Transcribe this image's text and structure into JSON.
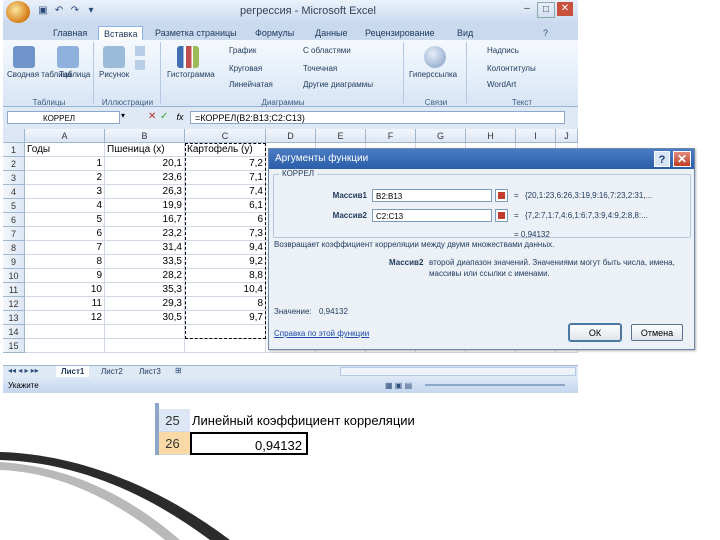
{
  "window": {
    "title": "регрессия - Microsoft Excel"
  },
  "tabs": [
    "Главная",
    "Вставка",
    "Разметка страницы",
    "Формулы",
    "Данные",
    "Рецензирование",
    "Вид"
  ],
  "ribbon": {
    "tables": {
      "pivot": "Сводная таблица",
      "table": "Таблица",
      "group": "Таблицы"
    },
    "illus": {
      "picture": "Рисунок",
      "group": "Иллюстрации"
    },
    "charts": {
      "histogram": "Гистограмма",
      "graph": "График",
      "pie": "Круговая",
      "linear": "Линейчатая",
      "area": "С областями",
      "scatter": "Точечная",
      "other": "Другие диаграммы",
      "group": "Диаграммы"
    },
    "links": {
      "hyperlink": "Гиперссылка",
      "group": "Связи"
    },
    "text": {
      "caption": "Надпись",
      "header": "Колонтитулы",
      "wordart": "WordArt",
      "group": "Текст"
    }
  },
  "namebox": "КОРРЕЛ",
  "fx": "fx",
  "formula": "=КОРРЕЛ(B2:B13;C2:C13)",
  "columns": [
    "A",
    "B",
    "C",
    "D",
    "E",
    "F",
    "G",
    "H",
    "I",
    "J"
  ],
  "rows": [
    {
      "n": "1",
      "a": "Годы",
      "b": "Пшеница (x)",
      "c": "Картофель (y)"
    },
    {
      "n": "2",
      "a": "1",
      "b": "20,1",
      "c": "7,2"
    },
    {
      "n": "3",
      "a": "2",
      "b": "23,6",
      "c": "7,1"
    },
    {
      "n": "4",
      "a": "3",
      "b": "26,3",
      "c": "7,4"
    },
    {
      "n": "5",
      "a": "4",
      "b": "19,9",
      "c": "6,1"
    },
    {
      "n": "6",
      "a": "5",
      "b": "16,7",
      "c": "6"
    },
    {
      "n": "7",
      "a": "6",
      "b": "23,2",
      "c": "7,3"
    },
    {
      "n": "8",
      "a": "7",
      "b": "31,4",
      "c": "9,4"
    },
    {
      "n": "9",
      "a": "8",
      "b": "33,5",
      "c": "9,2"
    },
    {
      "n": "10",
      "a": "9",
      "b": "28,2",
      "c": "8,8"
    },
    {
      "n": "11",
      "a": "10",
      "b": "35,3",
      "c": "10,4"
    },
    {
      "n": "12",
      "a": "11",
      "b": "29,3",
      "c": "8"
    },
    {
      "n": "13",
      "a": "12",
      "b": "30,5",
      "c": "9,7"
    },
    {
      "n": "14",
      "a": "",
      "b": "",
      "c": ""
    },
    {
      "n": "15",
      "a": "",
      "b": "",
      "c": ""
    }
  ],
  "sheets": [
    "Лист1",
    "Лист2",
    "Лист3"
  ],
  "status": "Укажите",
  "dialog": {
    "title": "Аргументы функции",
    "func": "КОРРЕЛ",
    "arg1_label": "Массив1",
    "arg1_value": "B2:B13",
    "arg1_result": "{20,1:23,6:26,3:19,9:16,7:23,2:31,...",
    "arg2_label": "Массив2",
    "arg2_value": "C2:C13",
    "arg2_result": "{7,2:7,1:7,4:6,1:6:7,3:9,4:9,2:8,8:...",
    "eq": "=",
    "result": "= 0,94132",
    "desc": "Возвращает коэффициент корреляции между двумя множествами данных.",
    "arg_help_label": "Массив2",
    "arg_help_1": "второй диапазон значений. Значениями могут быть числа, имена,",
    "arg_help_2": "массивы или ссылки с именами.",
    "value_label": "Значение:",
    "value": "0,94132",
    "help_link": "Справка по этой функции",
    "ok": "ОК",
    "cancel": "Отмена"
  },
  "snippet": {
    "row25_num": "25",
    "row25_text": "Линейный коэффициент корреляции",
    "row26_num": "26",
    "row26_value": "0,94132"
  }
}
